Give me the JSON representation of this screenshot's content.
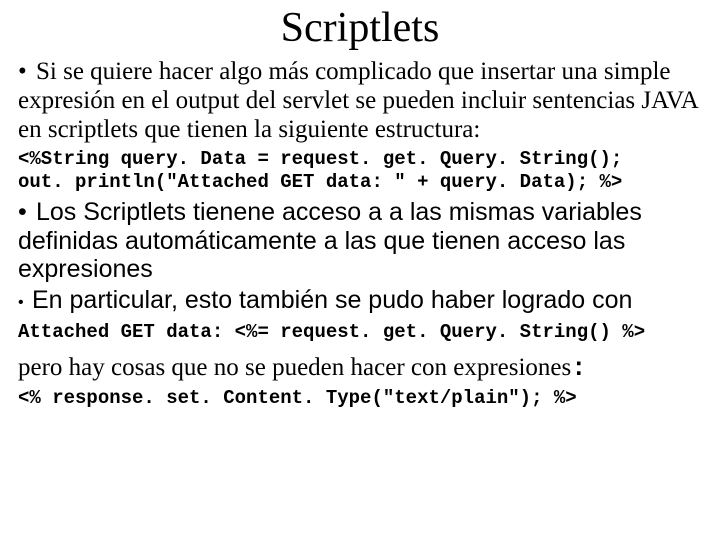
{
  "title": "Scriptlets",
  "p1": "Si se quiere hacer algo más complicado que insertar una simple expresión en el output del servlet se pueden incluir sentencias JAVA en scriptlets que tienen la siguiente estructura:",
  "code1_line1": "<%String query. Data = request. get. Query. String();",
  "code1_line2": "out. println(\"Attached GET data: \" + query. Data); %>",
  "p2": "Los Scriptlets tienene acceso a a las mismas variables definidas automáticamente a las que tienen acceso las expresiones",
  "p3": "En particular, esto también se pudo haber logrado con",
  "code2": "Attached GET data: <%= request. get. Query. String() %>",
  "p4": "pero hay cosas que no se pueden hacer con expresiones",
  "colon": ":",
  "code3": "<% response. set. Content. Type(\"text/plain\"); %>"
}
